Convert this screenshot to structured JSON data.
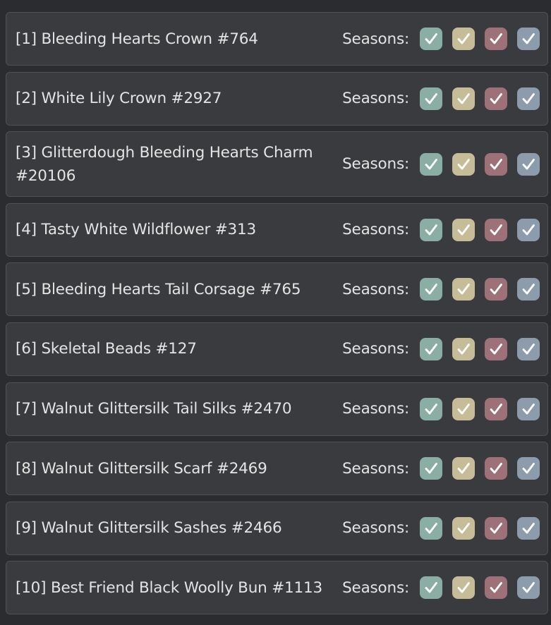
{
  "seasons_label": "Seasons:",
  "season_colors": [
    "#8aaea3",
    "#c6bc98",
    "#9e7077",
    "#8d9cad"
  ],
  "items": [
    {
      "title": "[1] Bleeding Hearts Crown #764",
      "checked": [
        true,
        true,
        true,
        true
      ]
    },
    {
      "title": "[2] White Lily Crown #2927",
      "checked": [
        true,
        true,
        true,
        true
      ]
    },
    {
      "title": "[3] Glitterdough Bleeding Hearts Charm #20106",
      "checked": [
        true,
        true,
        true,
        true
      ]
    },
    {
      "title": "[4] Tasty White Wildflower #313",
      "checked": [
        true,
        true,
        true,
        true
      ]
    },
    {
      "title": "[5] Bleeding Hearts Tail Corsage #765",
      "checked": [
        true,
        true,
        true,
        true
      ]
    },
    {
      "title": "[6] Skeletal Beads #127",
      "checked": [
        true,
        true,
        true,
        true
      ]
    },
    {
      "title": "[7] Walnut Glittersilk Tail Silks #2470",
      "checked": [
        true,
        true,
        true,
        true
      ]
    },
    {
      "title": "[8] Walnut Glittersilk Scarf #2469",
      "checked": [
        true,
        true,
        true,
        true
      ]
    },
    {
      "title": "[9] Walnut Glittersilk Sashes #2466",
      "checked": [
        true,
        true,
        true,
        true
      ]
    },
    {
      "title": "[10] Best Friend Black Woolly Bun #1113",
      "checked": [
        true,
        true,
        true,
        true
      ]
    }
  ]
}
